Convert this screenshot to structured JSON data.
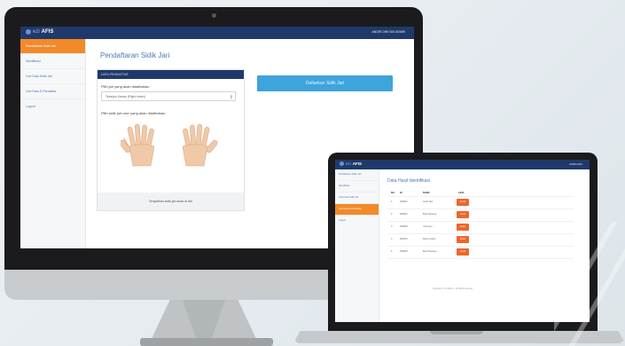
{
  "app": {
    "brand_prefix": "ezi",
    "brand_name": "AFIS"
  },
  "monitor": {
    "user_label": "ANDRI DWI 000 ADMIN",
    "sidebar": [
      "Pendaftaran Sidik Jari",
      "Identifikasi",
      "Cari Data Sidik Jari",
      "Cari Data E-Pendaftar",
      "Logout"
    ],
    "page_title": "Pendaftaran Sidik Jari",
    "card_header": "DATA PENDAFTAR",
    "select_label": "Pilih jari yang akan didaftarkan",
    "select_value": "Telunjuk Kanan (Right Index)",
    "capture_label": "Pilih sidik jari user yang akan didaftarkan",
    "capture_footer": "Tempelkan sidik jari anda di sini",
    "action_button": "Daftarkan Sidik Jari"
  },
  "laptop": {
    "user_label": "ADMIN AFIS",
    "sidebar": [
      "Pendaftaran Sidik Jari",
      "Identifikasi",
      "Cari Data Sidik Jari",
      "Cari Data E-Pendaftar",
      "Logout"
    ],
    "active_index": 3,
    "page_title": "Data Hasil Identifikasi",
    "table_headers": [
      "NO",
      "ID",
      "NAMA",
      "AKSI"
    ],
    "rows": [
      {
        "no": "1",
        "id": "000001",
        "name": "Andri Dwi",
        "action": "Detail"
      },
      {
        "no": "2",
        "id": "000002",
        "name": "Budi Santoso",
        "action": "Detail"
      },
      {
        "no": "3",
        "id": "000003",
        "name": "Citra Ayu",
        "action": "Detail"
      },
      {
        "no": "4",
        "id": "000004",
        "name": "Dewi Lestari",
        "action": "Detail"
      },
      {
        "no": "5",
        "id": "000005",
        "name": "Eko Prasetyo",
        "action": "Detail"
      }
    ],
    "footer": "Copyright © ezi AFIS — All rights reserved"
  }
}
